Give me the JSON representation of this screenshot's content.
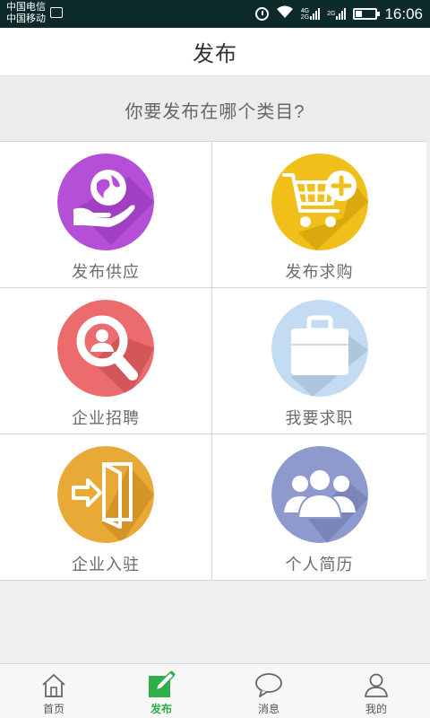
{
  "status_bar": {
    "carrier1": "中国电信",
    "carrier2": "中国移动",
    "net1": "4G",
    "net2": "2G",
    "net3": "2G",
    "time": "16:06"
  },
  "header": {
    "title": "发布"
  },
  "prompt": "你要发布在哪个类目?",
  "categories": [
    {
      "label": "发布供应",
      "icon": "globe-in-hand-icon",
      "color": "#b54fd8"
    },
    {
      "label": "发布求购",
      "icon": "shopping-cart-add-icon",
      "color": "#f0bf19"
    },
    {
      "label": "企业招聘",
      "icon": "magnifier-person-icon",
      "color": "#ec6b6c"
    },
    {
      "label": "我要求职",
      "icon": "briefcase-icon",
      "color": "#c3dcf3"
    },
    {
      "label": "企业入驻",
      "icon": "door-enter-icon",
      "color": "#e8a936"
    },
    {
      "label": "个人简历",
      "icon": "people-group-icon",
      "color": "#8e9acd"
    }
  ],
  "bottom_nav": [
    {
      "label": "首页",
      "icon": "home-icon",
      "active": false
    },
    {
      "label": "发布",
      "icon": "edit-icon",
      "active": true
    },
    {
      "label": "消息",
      "icon": "chat-bubble-icon",
      "active": false
    },
    {
      "label": "我的",
      "icon": "user-icon",
      "active": false
    }
  ],
  "colors": {
    "accent": "#2fae49",
    "background": "#efefef",
    "status_bar": "#0d2a2b"
  }
}
